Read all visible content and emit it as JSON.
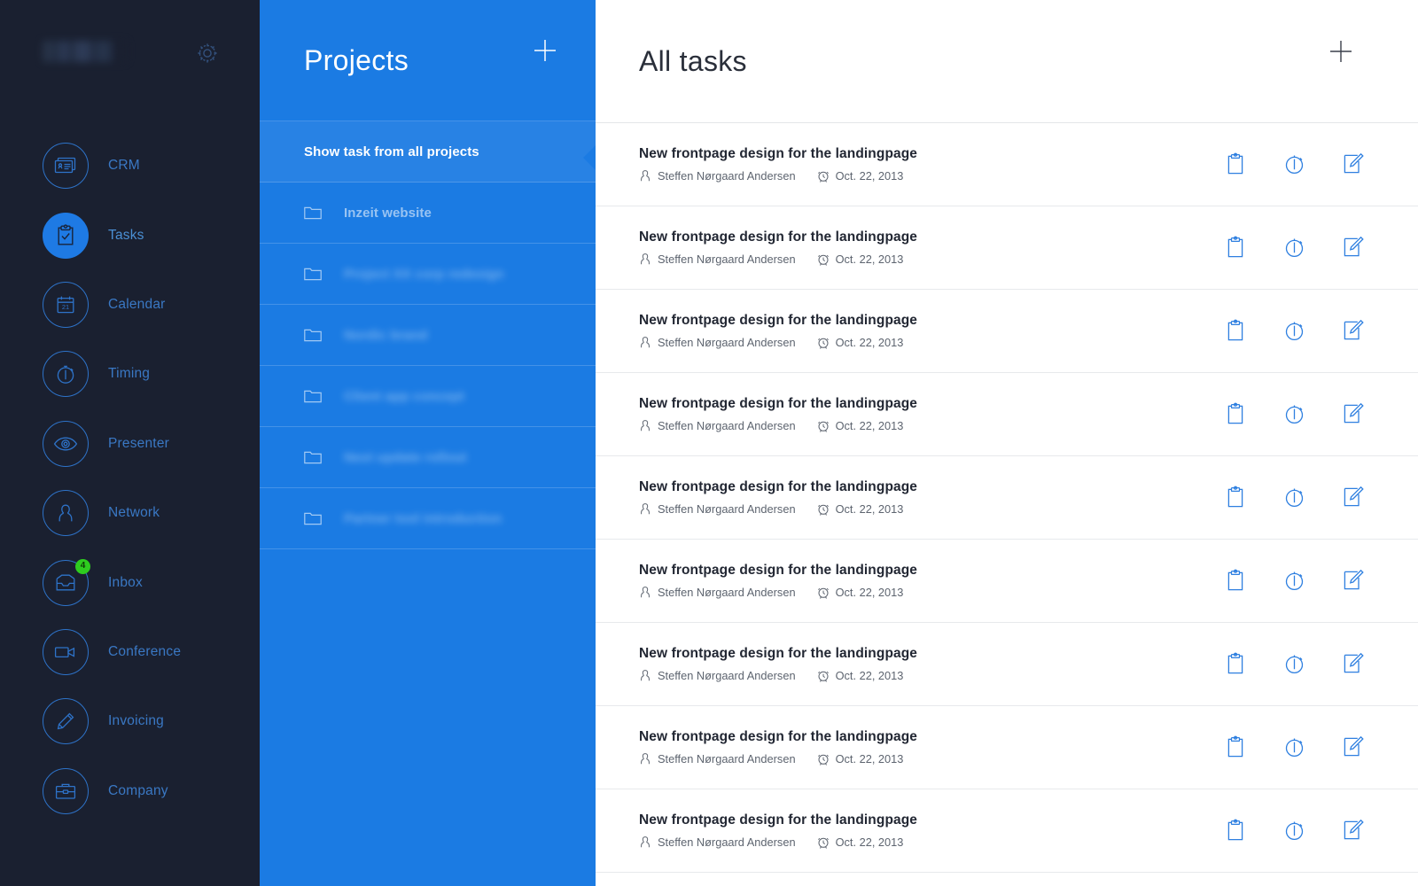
{
  "sidebar": {
    "logo": {
      "name": "app-logo",
      "redacted": true,
      "text": ""
    },
    "settings_icon": "gear-icon",
    "items": [
      {
        "label": "CRM",
        "icon": "crm-card-icon",
        "active": false,
        "badge": null
      },
      {
        "label": "Tasks",
        "icon": "clipboard-check-icon",
        "active": true,
        "badge": null
      },
      {
        "label": "Calendar",
        "icon": "calendar-21-icon",
        "active": false,
        "badge": null
      },
      {
        "label": "Timing",
        "icon": "stopwatch-icon",
        "active": false,
        "badge": null
      },
      {
        "label": "Presenter",
        "icon": "eye-icon",
        "active": false,
        "badge": null
      },
      {
        "label": "Network",
        "icon": "person-icon",
        "active": false,
        "badge": null
      },
      {
        "label": "Inbox",
        "icon": "inbox-tray-icon",
        "active": false,
        "badge": "4"
      },
      {
        "label": "Conference",
        "icon": "video-camera-icon",
        "active": false,
        "badge": null
      },
      {
        "label": "Invoicing",
        "icon": "pencil-icon",
        "active": false,
        "badge": null
      },
      {
        "label": "Company",
        "icon": "briefcase-icon",
        "active": false,
        "badge": null
      }
    ]
  },
  "projects": {
    "title": "Projects",
    "add_label": "+",
    "all_projects_label": "Show task from all projects",
    "items": [
      {
        "name": "Inzeit website",
        "redacted": false
      },
      {
        "name": "Project XX corp redesign",
        "redacted": true
      },
      {
        "name": "Nordic brand",
        "redacted": true
      },
      {
        "name": "Client app concept",
        "redacted": true
      },
      {
        "name": "Next update rollout",
        "redacted": true
      },
      {
        "name": "Partner tool introduction",
        "redacted": true
      }
    ]
  },
  "tasks": {
    "title": "All tasks",
    "add_label": "+",
    "rows": [
      {
        "title": "New frontpage design for the landingpage",
        "assignee": "Steffen Nørgaard Andersen",
        "due": "Oct. 22, 2013"
      },
      {
        "title": "New frontpage design for the landingpage",
        "assignee": "Steffen Nørgaard Andersen",
        "due": "Oct. 22, 2013"
      },
      {
        "title": "New frontpage design for the landingpage",
        "assignee": "Steffen Nørgaard Andersen",
        "due": "Oct. 22, 2013"
      },
      {
        "title": "New frontpage design for the landingpage",
        "assignee": "Steffen Nørgaard Andersen",
        "due": "Oct. 22, 2013"
      },
      {
        "title": "New frontpage design for the landingpage",
        "assignee": "Steffen Nørgaard Andersen",
        "due": "Oct. 22, 2013"
      },
      {
        "title": "New frontpage design for the landingpage",
        "assignee": "Steffen Nørgaard Andersen",
        "due": "Oct. 22, 2013"
      },
      {
        "title": "New frontpage design for the landingpage",
        "assignee": "Steffen Nørgaard Andersen",
        "due": "Oct. 22, 2013"
      },
      {
        "title": "New frontpage design for the landingpage",
        "assignee": "Steffen Nørgaard Andersen",
        "due": "Oct. 22, 2013"
      },
      {
        "title": "New frontpage design for the landingpage",
        "assignee": "Steffen Nørgaard Andersen",
        "due": "Oct. 22, 2013"
      }
    ],
    "row_actions": [
      "clipboard-icon",
      "stopwatch-icon",
      "edit-pencil-icon"
    ],
    "meta_icons": {
      "assignee": "person-icon",
      "due": "alarm-clock-icon"
    }
  },
  "colors": {
    "sidebar_bg": "#1a2030",
    "panel_blue": "#1b7be3",
    "accent_blue": "#1e7ae4",
    "nav_label": "#3a78c4",
    "badge_green": "#2ecc1f",
    "task_title": "#222733",
    "task_meta": "#5d646f",
    "divider": "#e7e9ec"
  }
}
